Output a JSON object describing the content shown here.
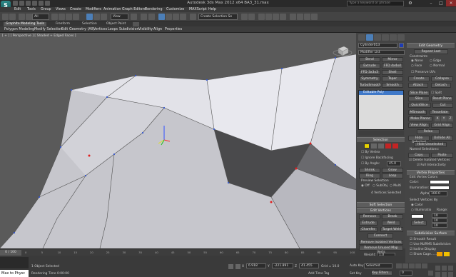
{
  "app": {
    "logo_letter": "S",
    "title": "Autodesk 3ds Max 2012 x64     BA3_31.max",
    "search_placeholder": "Type a keyword or phrase"
  },
  "menu": [
    "Edit",
    "Tools",
    "Group",
    "Views",
    "Create",
    "Modifiers",
    "Animation",
    "Graph Editors",
    "Rendering",
    "Customize",
    "MAXScript",
    "Help"
  ],
  "toolbar": {
    "filter_select": "All",
    "refcoord_select": "View",
    "selection_set": "Create Selection Se"
  },
  "ribbon": {
    "tabs": [
      "Graphite Modeling Tools",
      "Freeform",
      "Selection",
      "Object Paint"
    ],
    "subtabs": [
      "Polygon Modeling",
      "Modify Selection",
      "Edit",
      "Geometry (All)",
      "Vertices",
      "Loops",
      "Subdivision",
      "Visibility",
      "Align",
      "Properties"
    ]
  },
  "viewport": {
    "label": "[ + ] [ Perspective ] [ Shaded + Edged Faces ]"
  },
  "modify_panel": {
    "object_name": "Cylinder013",
    "modifier_list": "Modifier List",
    "modifier_buttons": [
      "Bend",
      "Mirror",
      "Extrude",
      "FFD 4x4x4",
      "FFD 3x3x3",
      "Shell",
      "Symmetry",
      "Taper",
      "TurboSmooth",
      "Smooth"
    ],
    "stack_item": "Editable Poly",
    "selection_title": "Selection",
    "by_vertex": "By Vertex",
    "ignore_backfacing": "Ignore Backfacing",
    "by_angle": "By Angle:",
    "by_angle_value": "45.0",
    "shrink": "Shrink",
    "grow": "Grow",
    "ring": "Ring",
    "loop": "Loop",
    "preview_selection": "Preview Selection",
    "preview_options": [
      "Off",
      "SubObj",
      "Multi"
    ],
    "selected_info": "4 Vertices Selected",
    "soft_selection": "Soft Selection",
    "edit_vertices": "Edit Vertices",
    "remove": "Remove",
    "break": "Break",
    "extrude": "Extrude",
    "weld": "Weld",
    "chamfer": "Chamfer",
    "target_weld": "Target Weld",
    "connect": "Connect",
    "remove_isolated": "Remove Isolated Vertices",
    "remove_unused": "Remove Unused Map Verts",
    "weight_label": "Weight:",
    "weight_value": "1.0"
  },
  "cmd_panel": {
    "edit_geometry": "Edit Geometry",
    "repeat_last": "Repeat Last",
    "constraints": "Constraints",
    "constraint_opts": [
      "None",
      "Edge",
      "Face",
      "Normal"
    ],
    "preserve_uvs": "Preserve UVs",
    "create": "Create",
    "collapse": "Collapse",
    "attach": "Attach",
    "detach": "Detach",
    "slice_plane": "Slice Plane",
    "split": "Split",
    "slice": "Slice",
    "reset_plane": "Reset Plane",
    "quickslice": "QuickSlice",
    "cut": "Cut",
    "msmooth": "MSmooth",
    "tessellate": "Tessellate",
    "make_planar": "Make Planar",
    "view_align": "View Align",
    "grid_align": "Grid Align",
    "relax": "Relax",
    "hide_selected": "Hide Selected",
    "unhide_all": "Unhide All",
    "hide_unselected": "Hide Unselected",
    "named_selections": "Named Selections:",
    "copy": "Copy",
    "paste": "Paste",
    "delete_isolated": "Delete Isolated Vertices",
    "full_interactivity": "Full Interactivity",
    "vertex_properties": "Vertex Properties",
    "edit_vertex_colors": "Edit Vertex Colors",
    "color": "Color:",
    "illumination": "Illumination:",
    "alpha": "Alpha:",
    "alpha_value": "100.0",
    "select_by": "Select Vertices By",
    "sel_color": "Color",
    "sel_illum": "Illuminatio",
    "range": "Range:",
    "range_values": [
      "10",
      "10",
      "10"
    ],
    "select": "Select",
    "subdivision_surface": "Subdivision Surface",
    "smooth_result": "Smooth Result",
    "use_nurms": "Use NURMS Subdivision",
    "isoline_display": "Isoline Display",
    "show_cage": "Show Cage......"
  },
  "timeline": {
    "frame_display": "0 / 100",
    "ticks": [
      "0",
      "5",
      "10",
      "15",
      "20",
      "25",
      "30",
      "35",
      "40",
      "45",
      "50",
      "55",
      "60",
      "65",
      "70",
      "75",
      "80",
      "85",
      "90",
      "95",
      "100"
    ]
  },
  "status": {
    "maxscript": "Max to Physc",
    "selected": "1 Object Selected",
    "rendering_time": "Rendering Time 0:00:00",
    "x_value": "6.918",
    "y_value": "-221.891",
    "z_value": "41.455",
    "grid": "Grid = 10.0",
    "add_time_tag": "Add Time Tag",
    "auto_key": "Auto Key",
    "set_key": "Set Key",
    "selected_mode": "Selected",
    "key_filters": "Key Filters...",
    "frame_spinner": "0"
  },
  "colors": {
    "accent_blue": "#4c7fb8",
    "vertex_red": "#e02020",
    "mesh_light": "#e2e2e8"
  }
}
